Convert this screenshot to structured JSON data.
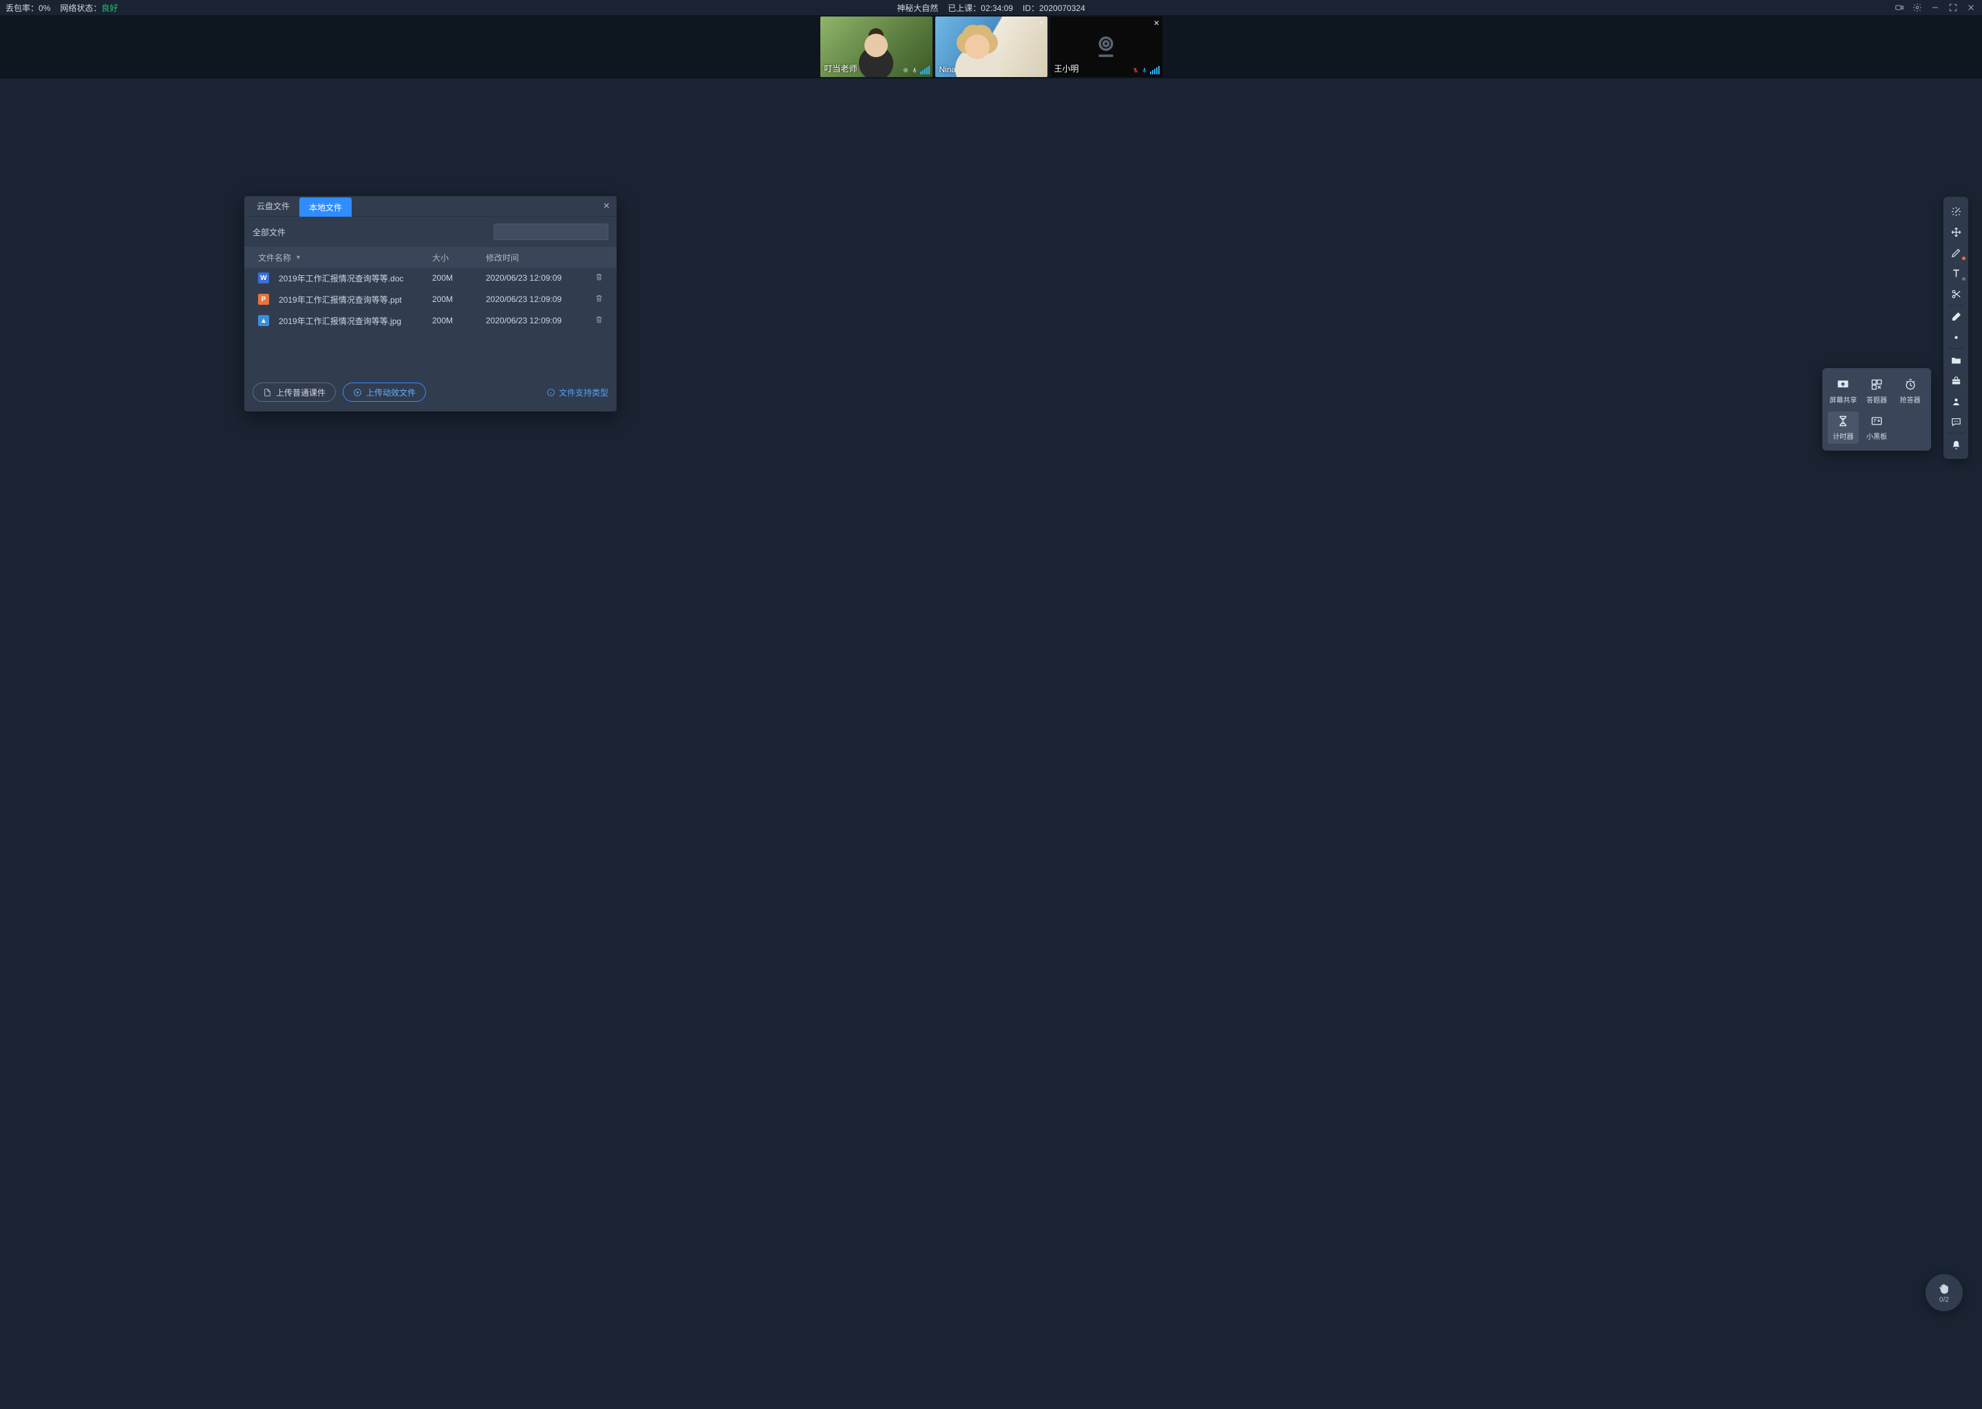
{
  "topbar": {
    "packet_loss_label": "丢包率：",
    "packet_loss_value": "0%",
    "net_label": "网络状态：",
    "net_value": "良好",
    "title": "神秘大自然",
    "class_label": "已上课：",
    "class_time": "02:34:09",
    "id_label": "ID：",
    "id_value": "2020070324"
  },
  "participants": [
    {
      "name": "叮当老师",
      "cam_on": true,
      "closable": false,
      "mic_muted": false
    },
    {
      "name": "Nina",
      "cam_on": true,
      "closable": true,
      "mic_muted": false
    },
    {
      "name": "王小明",
      "cam_on": false,
      "closable": true,
      "mic_muted": true
    }
  ],
  "modal": {
    "tab_cloud": "云盘文件",
    "tab_local": "本地文件",
    "section_label": "全部文件",
    "col_name": "文件名称",
    "col_size": "大小",
    "col_time": "修改时间",
    "files": [
      {
        "icon": "w",
        "icon_glyph": "W",
        "name": "2019年工作汇报情况查询等等.doc",
        "size": "200M",
        "time": "2020/06/23 12:09:09"
      },
      {
        "icon": "p",
        "icon_glyph": "P",
        "name": "2019年工作汇报情况查询等等.ppt",
        "size": "200M",
        "time": "2020/06/23 12:09:09"
      },
      {
        "icon": "i",
        "icon_glyph": "▲",
        "name": "2019年工作汇报情况查询等等.jpg",
        "size": "200M",
        "time": "2020/06/23 12:09:09"
      }
    ],
    "btn_upload_plain": "上传普通课件",
    "btn_upload_anim": "上传动效文件",
    "link_types": "文件支持类型"
  },
  "tools_popup": {
    "screen_share": "屏幕共享",
    "answer": "答题器",
    "rush": "抢答器",
    "timer": "计时器",
    "blackboard": "小黑板"
  },
  "right_toolbar_items": [
    "laser-pointer",
    "move",
    "pen",
    "text",
    "scissors",
    "eraser",
    "shape-dot",
    "folder",
    "toolbox",
    "person",
    "chat",
    "bell"
  ],
  "hand_raise": {
    "count": "0/2"
  }
}
